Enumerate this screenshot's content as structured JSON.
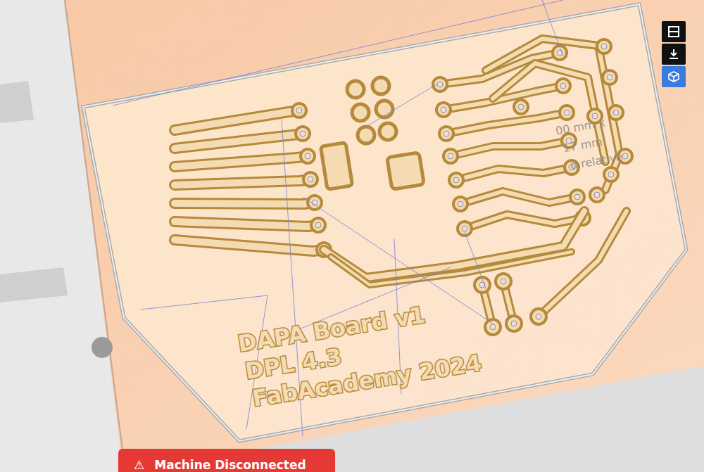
{
  "toolbar": [
    {
      "kind": "layers",
      "selected": false
    },
    {
      "kind": "download",
      "selected": false
    },
    {
      "kind": "cube",
      "selected": true
    }
  ],
  "board": {
    "labels": [
      "DAPA Board v1",
      "DPL 4.3",
      "FabAcademy 2024"
    ]
  },
  "measure": [
    "00 mm x",
    "17 mm",
    "d relative"
  ],
  "status": {
    "icon": "⚠",
    "text": "Machine Disconnected"
  }
}
